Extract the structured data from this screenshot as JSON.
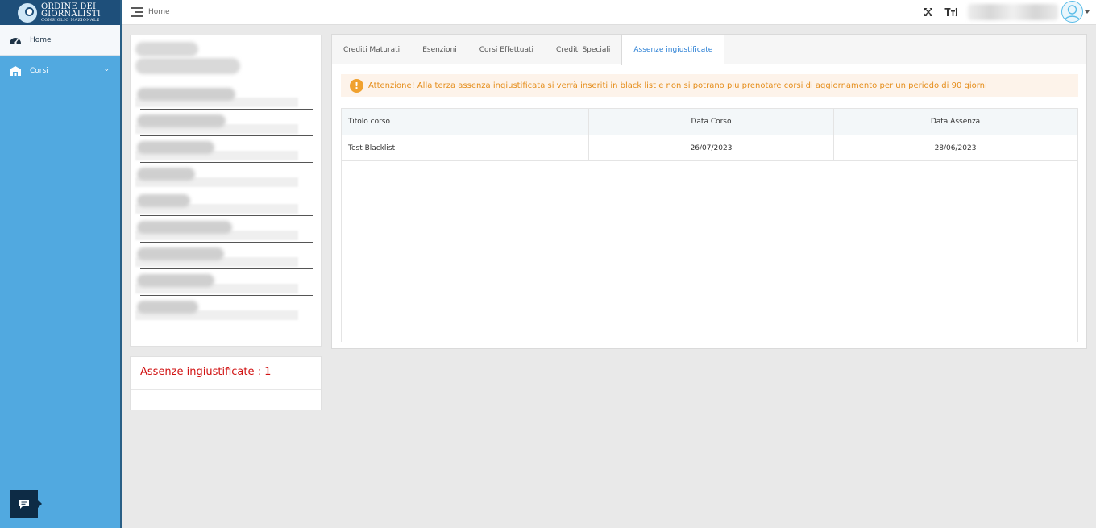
{
  "brand": {
    "line1": "ORDINE DEI",
    "line2": "GIORNALISTI",
    "line3": "CONSIGLIO NAZIONALE"
  },
  "sidebar": {
    "items": [
      {
        "label": "Home",
        "icon": "dashboard-icon",
        "active": true
      },
      {
        "label": "Corsi",
        "icon": "institution-icon",
        "active": false
      }
    ]
  },
  "topbar": {
    "breadcrumb": "Home"
  },
  "assenze_card": {
    "title": "Assenze ingiustificate : 1"
  },
  "tabs": [
    {
      "label": "Crediti Maturati",
      "active": false
    },
    {
      "label": "Esenzioni",
      "active": false
    },
    {
      "label": "Corsi Effettuati",
      "active": false
    },
    {
      "label": "Crediti Speciali",
      "active": false
    },
    {
      "label": "Assenze ingiustificate",
      "active": true
    }
  ],
  "alert": {
    "text": "Attenzione! Alla terza assenza ingiustificata si verrà inseriti in black list e non si potrano piu prenotare corsi di aggiornamento per un periodo di 90 giorni"
  },
  "table": {
    "headers": [
      "Titolo corso",
      "Data Corso",
      "Data Assenza"
    ],
    "rows": [
      [
        "Test Blacklist",
        "26/07/2023",
        "28/06/2023"
      ]
    ]
  },
  "colors": {
    "sidebar": "#51a9e0",
    "brand": "#1e4f7a",
    "alert_text": "#e58d1a",
    "danger": "#d11313",
    "active_tab": "#2a7fd4"
  }
}
